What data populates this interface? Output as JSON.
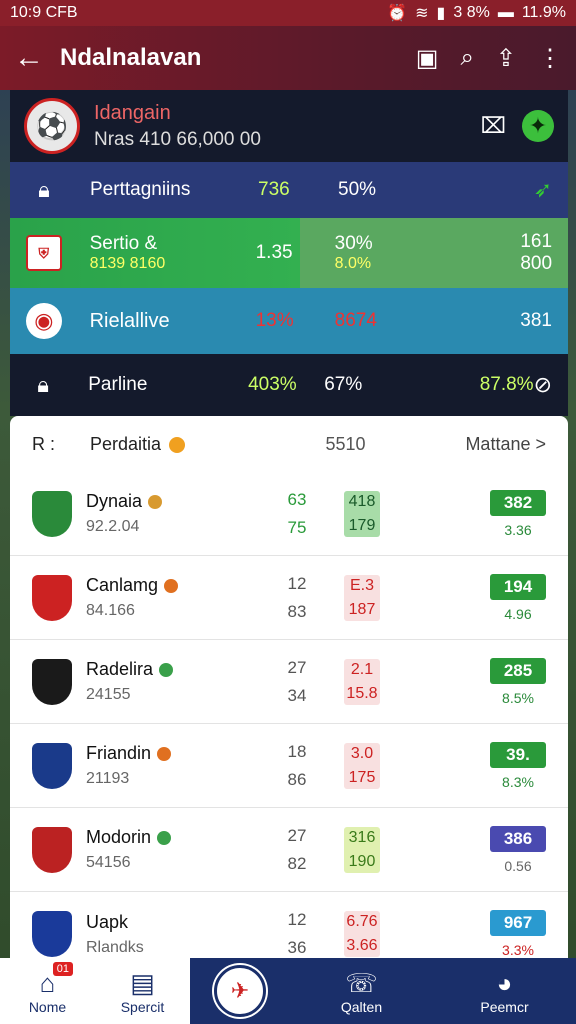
{
  "status": {
    "time": "10:9 CFB",
    "battery_a": "3 8%",
    "battery_b": "11.9%"
  },
  "appbar": {
    "title": "Ndalnalavan"
  },
  "profile": {
    "name": "Idangain",
    "sub": "Nras 410 66,000 00"
  },
  "summary_rows": [
    {
      "label": "Perttagniins",
      "c1": "736",
      "c2": "50%",
      "c3": ""
    },
    {
      "label": "Sertio &",
      "label2": "8139 8160",
      "c1": "1.35",
      "c2": "30%",
      "c2b": "8.0%",
      "c3": "161",
      "c3b": "800"
    },
    {
      "label": "Rielallive",
      "c1": "13%",
      "c2": "8674",
      "c3": "381"
    },
    {
      "label": "Parline",
      "c1": "403%",
      "c2": "67%",
      "c3": "87.8%"
    }
  ],
  "list": {
    "prefix": "R :",
    "header": "Perdaitia",
    "mid": "5510",
    "more": "Mattane >",
    "items": [
      {
        "name": "Dynaia",
        "sub": "92.2.04",
        "s1": "63",
        "s2": "75",
        "p1": "418",
        "p2": "179",
        "score": "382",
        "pct": "3.36",
        "crest": "#2a8a3a",
        "pill": "#a8dca8",
        "pillText": "#1a5a2a",
        "scoreBg": "#2a9a3a",
        "pctColor": "#2a8a3a",
        "dot": "#d89a30"
      },
      {
        "name": "Canlamg",
        "sub": "84.166",
        "s1": "12",
        "s2": "83",
        "p1": "E.3",
        "p2": "187",
        "score": "194",
        "pct": "4.96",
        "crest": "#c22",
        "pill": "#f8e0e0",
        "pillText": "#c22",
        "scoreBg": "#2a9a3a",
        "pctColor": "#2a8a3a",
        "dot": "#e07020"
      },
      {
        "name": "Radelira",
        "sub": "24155",
        "s1": "27",
        "s2": "34",
        "p1": "2.1",
        "p2": "15.8",
        "score": "285",
        "pct": "8.5%",
        "crest": "#1a1a1a",
        "pill": "#f8e0e0",
        "pillText": "#c22",
        "scoreBg": "#2a9a3a",
        "pctColor": "#2a8a3a",
        "dot": "#3aa04a"
      },
      {
        "name": "Friandin",
        "sub": "21193",
        "s1": "18",
        "s2": "86",
        "p1": "3.0",
        "p2": "175",
        "score": "39.",
        "pct": "8.3%",
        "crest": "#1a3a8a",
        "pill": "#f8e0e0",
        "pillText": "#c22",
        "scoreBg": "#2a9a3a",
        "pctColor": "#2a8a3a",
        "dot": "#e07020"
      },
      {
        "name": "Modorin",
        "sub": "54156",
        "s1": "27",
        "s2": "82",
        "p1": "316",
        "p2": "190",
        "score": "386",
        "pct": "0.56",
        "crest": "#b22",
        "pill": "#e0f0b0",
        "pillText": "#3a7a1a",
        "scoreBg": "#4a4ab0",
        "pctColor": "#666",
        "dot": "#3aa04a"
      },
      {
        "name": "Uapk",
        "sub": "Rlandks",
        "s1": "12",
        "s2": "36",
        "p1": "6.76",
        "p2": "3.66",
        "score": "967",
        "pct": "3.3%",
        "crest": "#1a3a9a",
        "pill": "#f8e0e0",
        "pillText": "#c22",
        "scoreBg": "#2a9ad0",
        "pctColor": "#c22",
        "dot": ""
      }
    ]
  },
  "nav": {
    "home": "Nome",
    "home_badge": "01",
    "sport": "Spercit",
    "calls": "Qalten",
    "profile": "Peemcr"
  },
  "icons": [
    "back-arrow-icon",
    "square-icon",
    "search-icon",
    "share-icon",
    "more-icon",
    "lock-icon",
    "bookmark-icon",
    "badge-icon",
    "trend-icon",
    "clock-icon",
    "home-icon",
    "phone-icon",
    "user-icon",
    "ball-icon"
  ]
}
